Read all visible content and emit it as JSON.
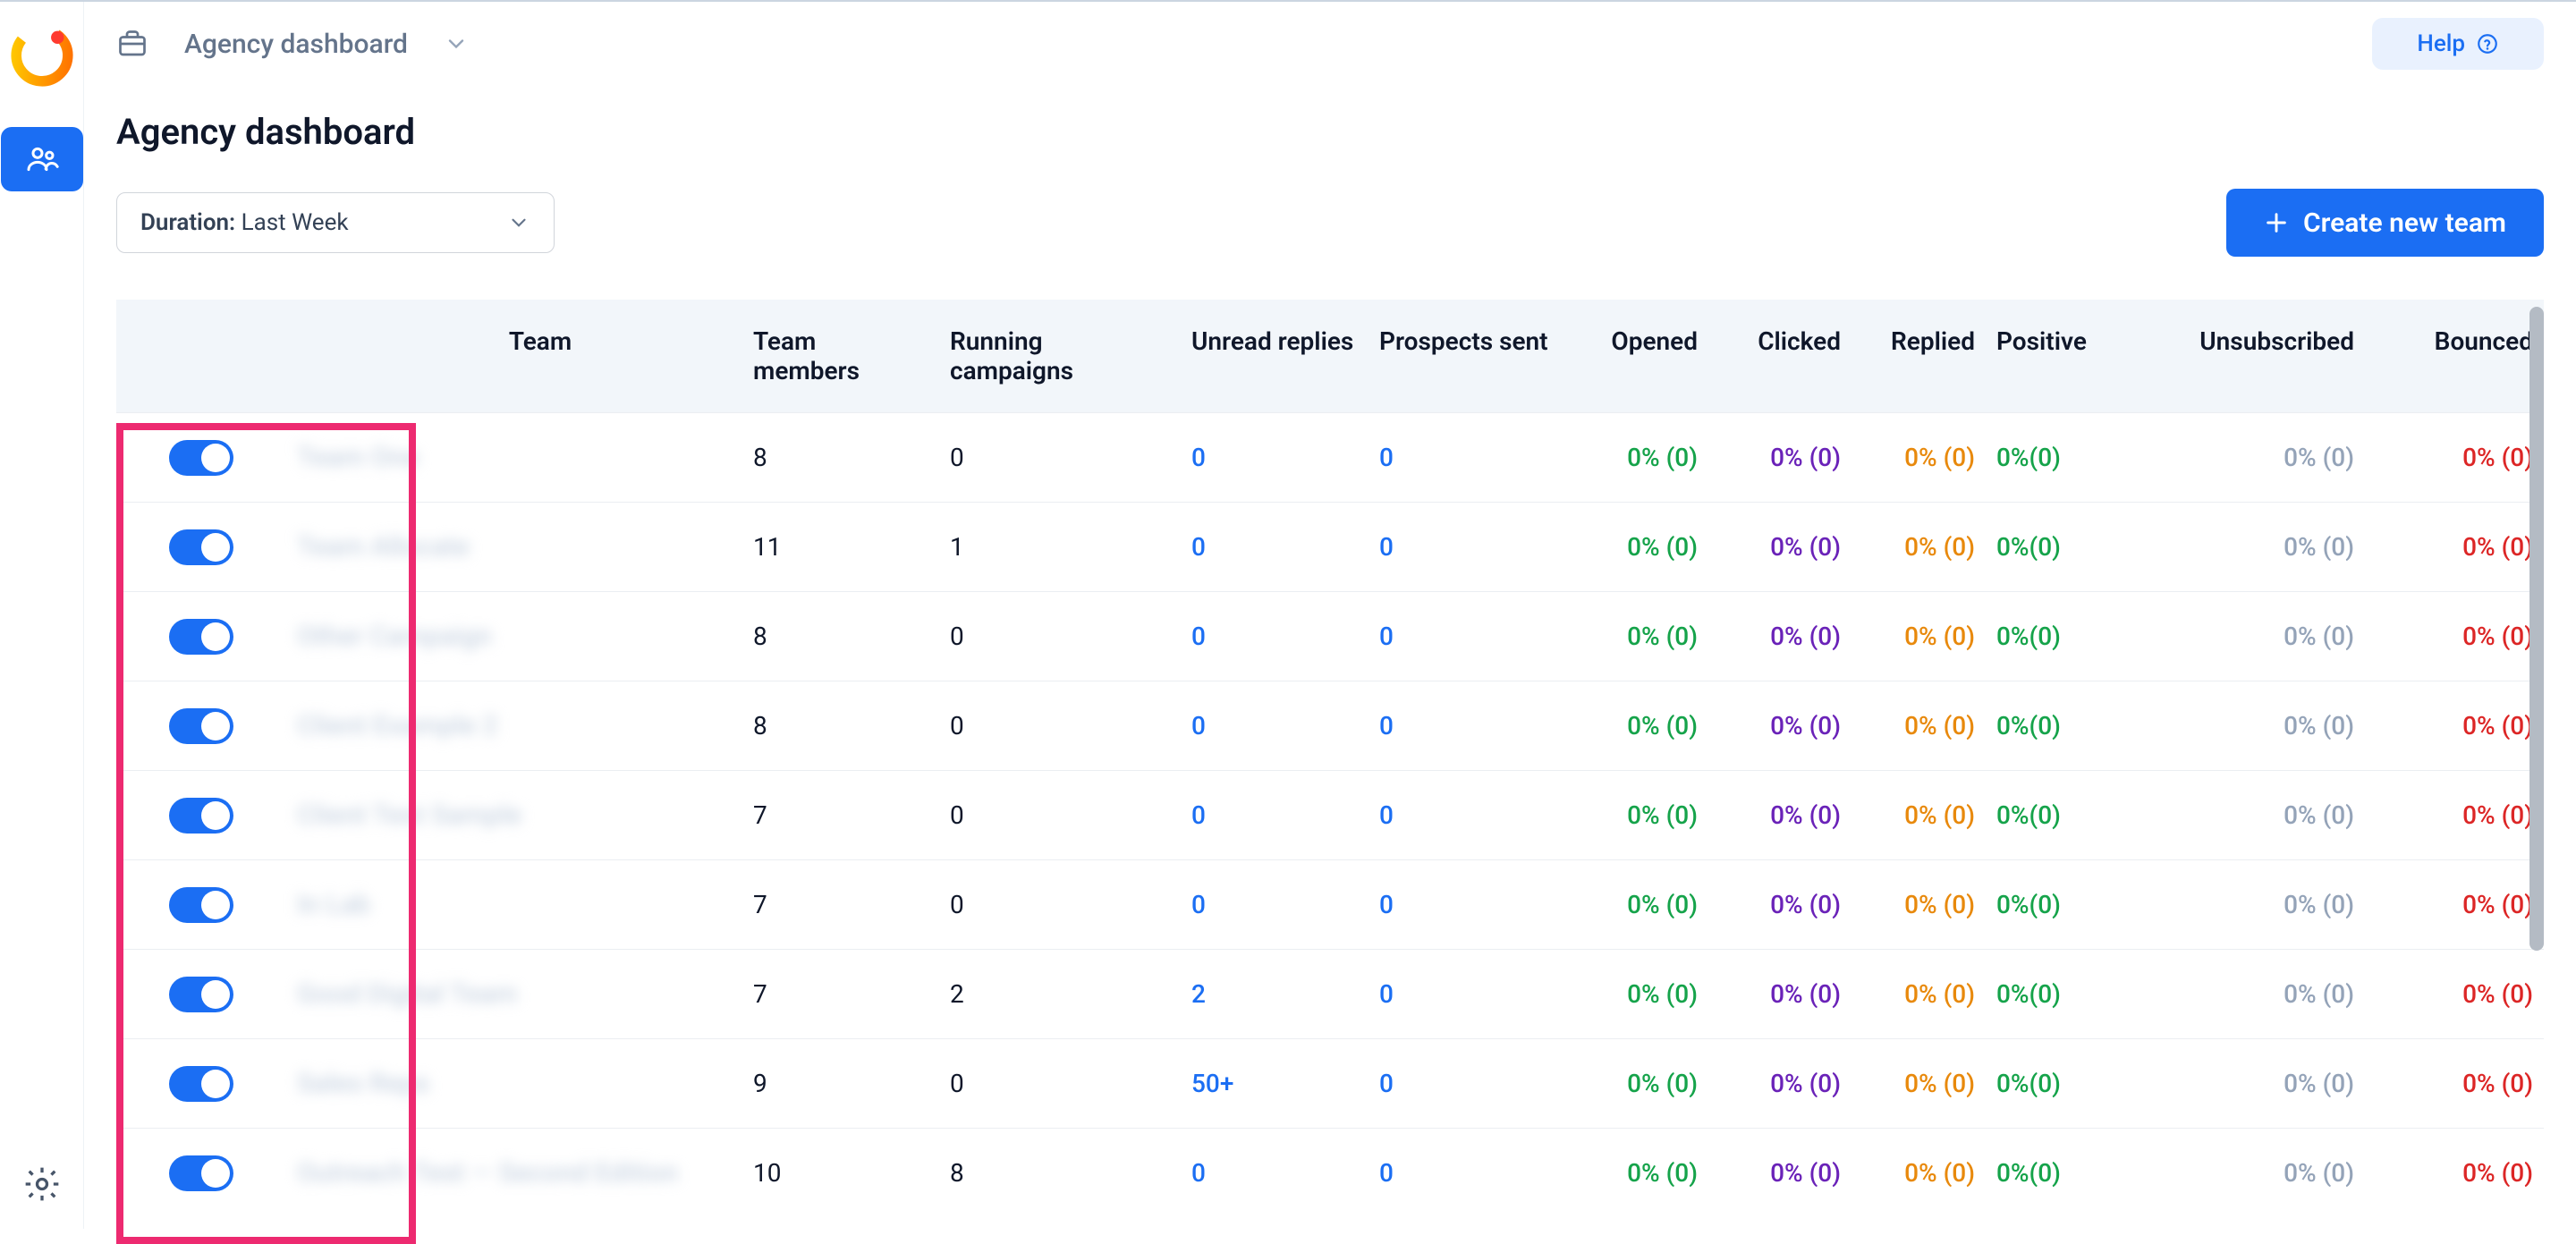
{
  "breadcrumb": {
    "title": "Agency dashboard"
  },
  "help": {
    "label": "Help"
  },
  "page": {
    "title": "Agency dashboard"
  },
  "duration": {
    "prefix": "Duration:",
    "value": "Last Week"
  },
  "create_button": {
    "label": "Create new team"
  },
  "columns": {
    "team": "Team",
    "members": "Team members",
    "running": "Running campaigns",
    "unread": "Unread replies",
    "prospects": "Prospects sent",
    "opened": "Opened",
    "clicked": "Clicked",
    "replied": "Replied",
    "positive": "Positive",
    "unsubscribed": "Unsubscribed",
    "bounced": "Bounced"
  },
  "rows": [
    {
      "toggle": true,
      "team": "Team One",
      "members": "8",
      "running": "0",
      "unread": "0",
      "prospects": "0",
      "opened": "0% (0)",
      "clicked": "0% (0)",
      "replied": "0% (0)",
      "positive": "0%(0)",
      "unsub": "0% (0)",
      "bounced": "0% (0)"
    },
    {
      "toggle": true,
      "team": "Team Allocate",
      "members": "11",
      "running": "1",
      "unread": "0",
      "prospects": "0",
      "opened": "0% (0)",
      "clicked": "0% (0)",
      "replied": "0% (0)",
      "positive": "0%(0)",
      "unsub": "0% (0)",
      "bounced": "0% (0)"
    },
    {
      "toggle": true,
      "team": "Other Campaign",
      "members": "8",
      "running": "0",
      "unread": "0",
      "prospects": "0",
      "opened": "0% (0)",
      "clicked": "0% (0)",
      "replied": "0% (0)",
      "positive": "0%(0)",
      "unsub": "0% (0)",
      "bounced": "0% (0)"
    },
    {
      "toggle": true,
      "team": "Client Example 2",
      "members": "8",
      "running": "0",
      "unread": "0",
      "prospects": "0",
      "opened": "0% (0)",
      "clicked": "0% (0)",
      "replied": "0% (0)",
      "positive": "0%(0)",
      "unsub": "0% (0)",
      "bounced": "0% (0)"
    },
    {
      "toggle": true,
      "team": "Client Test Sample",
      "members": "7",
      "running": "0",
      "unread": "0",
      "prospects": "0",
      "opened": "0% (0)",
      "clicked": "0% (0)",
      "replied": "0% (0)",
      "positive": "0%(0)",
      "unsub": "0% (0)",
      "bounced": "0% (0)"
    },
    {
      "toggle": true,
      "team": "In Lab",
      "members": "7",
      "running": "0",
      "unread": "0",
      "prospects": "0",
      "opened": "0% (0)",
      "clicked": "0% (0)",
      "replied": "0% (0)",
      "positive": "0%(0)",
      "unsub": "0% (0)",
      "bounced": "0% (0)"
    },
    {
      "toggle": true,
      "team": "Good Digital Team",
      "members": "7",
      "running": "2",
      "unread": "2",
      "prospects": "0",
      "opened": "0% (0)",
      "clicked": "0% (0)",
      "replied": "0% (0)",
      "positive": "0%(0)",
      "unsub": "0% (0)",
      "bounced": "0% (0)"
    },
    {
      "toggle": true,
      "team": "Sales Reps",
      "members": "9",
      "running": "0",
      "unread": "50+",
      "prospects": "0",
      "opened": "0% (0)",
      "clicked": "0% (0)",
      "replied": "0% (0)",
      "positive": "0%(0)",
      "unsub": "0% (0)",
      "bounced": "0% (0)"
    },
    {
      "toggle": true,
      "team": "Outreach Test — Second Edition",
      "members": "10",
      "running": "8",
      "unread": "0",
      "prospects": "0",
      "opened": "0% (0)",
      "clicked": "0% (0)",
      "replied": "0% (0)",
      "positive": "0%(0)",
      "unsub": "0% (0)",
      "bounced": "0% (0)"
    }
  ],
  "colors": {
    "accent": "#1b6ef3",
    "highlight": "#ed2a70"
  }
}
